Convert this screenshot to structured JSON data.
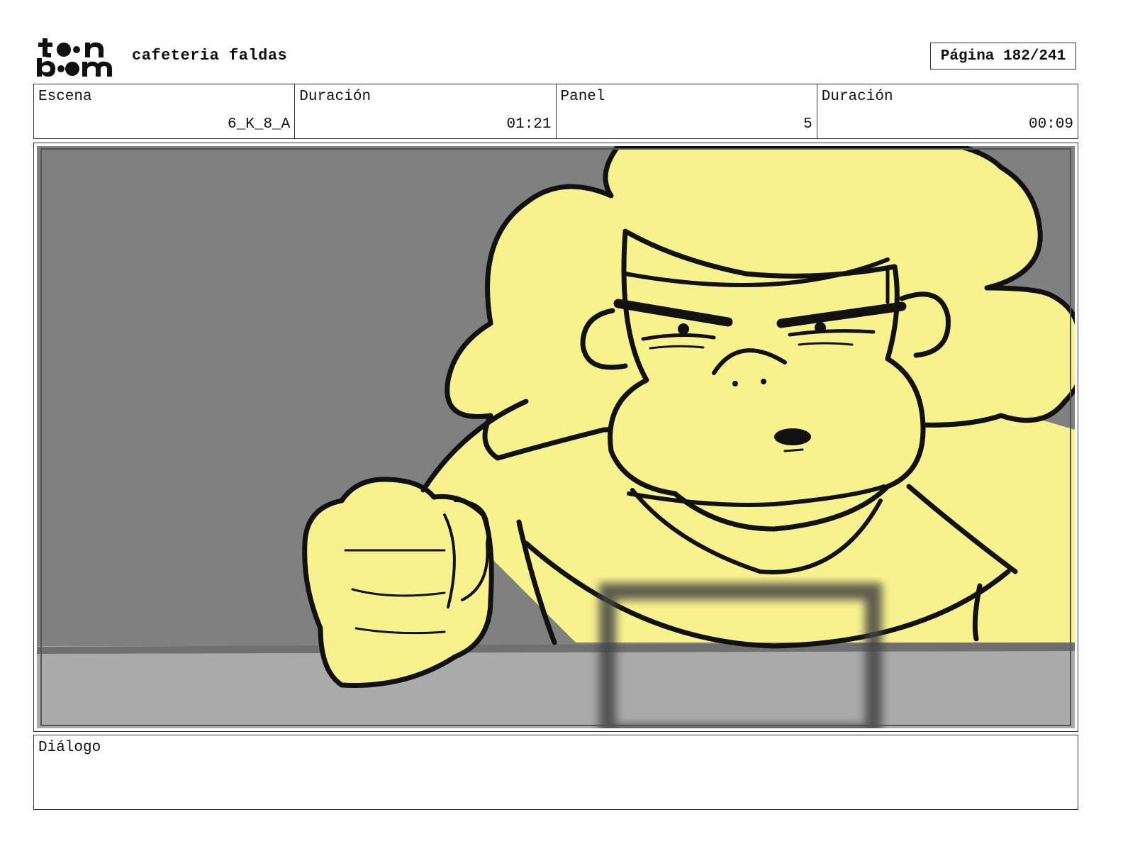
{
  "header": {
    "logo_text": "toon boom",
    "project_title": "cafeteria faldas",
    "page_label": "Página 182/241"
  },
  "info": {
    "scene_label": "Escena",
    "scene_value": "6_K_8_A",
    "scene_duration_label": "Duración",
    "scene_duration_value": "01:21",
    "panel_label": "Panel",
    "panel_value": "5",
    "panel_duration_label": "Duración",
    "panel_duration_value": "00:09"
  },
  "dialog": {
    "label": "Diálogo",
    "text": ""
  },
  "colors": {
    "character_fill": "#f7f28e",
    "background_wall": "#808080",
    "table_top": "#aaaaaa",
    "outline": "#111111"
  }
}
